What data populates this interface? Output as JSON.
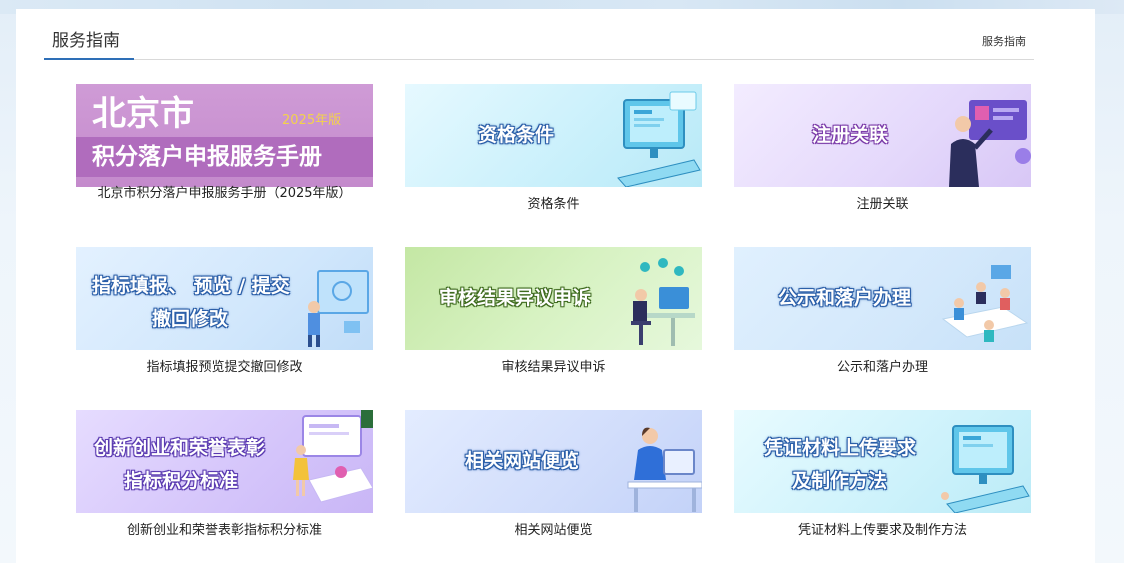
{
  "header": {
    "title": "服务指南",
    "breadcrumb": "服务指南"
  },
  "cards": [
    {
      "label": "北京市积分落户申报服务手册（2025年版）",
      "banner_line1": "北京市",
      "banner_line2": "积分落户申报服务手册",
      "banner_year": "2025年版"
    },
    {
      "label": "资格条件",
      "banner": "资格条件"
    },
    {
      "label": "注册关联",
      "banner": "注册关联"
    },
    {
      "label": "指标填报预览提交撤回修改",
      "banner_line1": "指标填报、 预览 / 提交",
      "banner_line2": "撤回修改"
    },
    {
      "label": "审核结果异议申诉",
      "banner": "审核结果异议申诉"
    },
    {
      "label": "公示和落户办理",
      "banner": "公示和落户办理"
    },
    {
      "label": "创新创业和荣誉表彰指标积分标准",
      "banner_line1": "创新创业和荣誉表彰",
      "banner_line2": "指标积分标准"
    },
    {
      "label": "相关网站便览",
      "banner": "相关网站便览"
    },
    {
      "label": "凭证材料上传要求及制作方法",
      "banner_line1": "凭证材料上传要求",
      "banner_line2": "及制作方法"
    }
  ],
  "colors": {
    "accent": "#2e6fb7",
    "card1_bg": "#c98fcf",
    "card1_strip": "#a85fb4"
  }
}
